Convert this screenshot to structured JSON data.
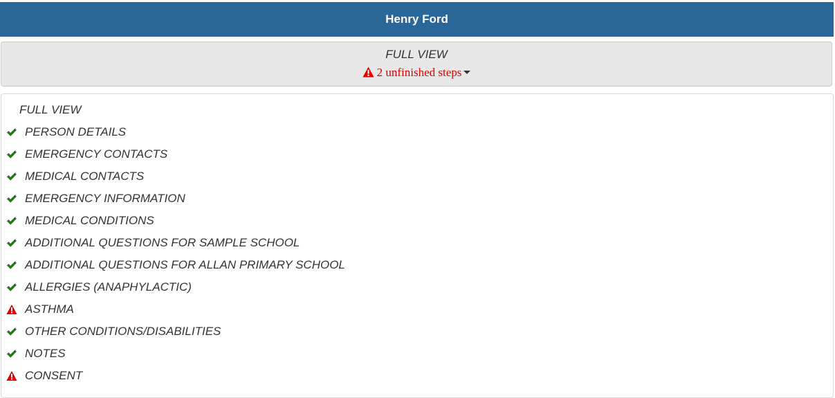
{
  "header": {
    "title": "Henry Ford"
  },
  "summary": {
    "title": "FULL VIEW",
    "status_text": "2 unfinished steps",
    "status_icon": "warning-icon"
  },
  "nav": {
    "full_view_label": "FULL VIEW",
    "steps": [
      {
        "label": "PERSON DETAILS",
        "status": "complete",
        "icon": "check-icon"
      },
      {
        "label": "EMERGENCY CONTACTS",
        "status": "complete",
        "icon": "check-icon"
      },
      {
        "label": "MEDICAL CONTACTS",
        "status": "complete",
        "icon": "check-icon"
      },
      {
        "label": "EMERGENCY INFORMATION",
        "status": "complete",
        "icon": "check-icon"
      },
      {
        "label": "MEDICAL CONDITIONS",
        "status": "complete",
        "icon": "check-icon"
      },
      {
        "label": "ADDITIONAL QUESTIONS FOR SAMPLE SCHOOL",
        "status": "complete",
        "icon": "check-icon"
      },
      {
        "label": "ADDITIONAL QUESTIONS FOR ALLAN PRIMARY SCHOOL",
        "status": "complete",
        "icon": "check-icon"
      },
      {
        "label": "ALLERGIES (ANAPHYLACTIC)",
        "status": "complete",
        "icon": "check-icon"
      },
      {
        "label": "ASTHMA",
        "status": "unfinished",
        "icon": "warning-icon"
      },
      {
        "label": "OTHER CONDITIONS/DISABILITIES",
        "status": "complete",
        "icon": "check-icon"
      },
      {
        "label": "NOTES",
        "status": "complete",
        "icon": "check-icon"
      },
      {
        "label": "CONSENT",
        "status": "unfinished",
        "icon": "warning-icon"
      }
    ]
  },
  "colors": {
    "header_bg": "#2b6699",
    "check": "#1a7a1a",
    "warning": "#e10000"
  }
}
